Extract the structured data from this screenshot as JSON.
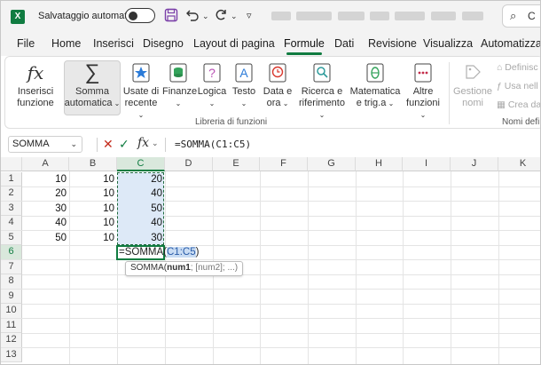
{
  "titlebar": {
    "app_icon": "X",
    "autosave_label": "Salvataggio automatico",
    "autosave_state": "off",
    "icons": [
      "save-icon",
      "undo-icon",
      "redo-icon",
      "customize-icon"
    ],
    "search_label": "C"
  },
  "tabs": [
    {
      "label": "File"
    },
    {
      "label": "Home"
    },
    {
      "label": "Inserisci"
    },
    {
      "label": "Disegno"
    },
    {
      "label": "Layout di pagina"
    },
    {
      "label": "Formule",
      "active": true
    },
    {
      "label": "Dati"
    },
    {
      "label": "Revisione"
    },
    {
      "label": "Visualizza"
    },
    {
      "label": "Automatizza"
    }
  ],
  "ribbon": {
    "insert_function": {
      "line1": "Inserisci",
      "line2": "funzione",
      "icon": "fx-icon"
    },
    "autosum": {
      "line1": "Somma",
      "line2": "automatica",
      "icon": "sigma-icon"
    },
    "recent": {
      "line1": "Usate di",
      "line2": "recente",
      "icon": "star-icon"
    },
    "finance": {
      "line1": "Finanze",
      "icon": "finance-icon"
    },
    "logic": {
      "line1": "Logica",
      "icon": "question-icon"
    },
    "text": {
      "line1": "Testo",
      "icon": "text-icon"
    },
    "datetime": {
      "line1": "Data e",
      "line2": "ora",
      "icon": "clock-icon"
    },
    "lookup": {
      "line1": "Ricerca e",
      "line2": "riferimento",
      "icon": "lookup-icon"
    },
    "math": {
      "line1": "Matematica",
      "line2": "e trig.a",
      "icon": "theta-icon"
    },
    "more": {
      "line1": "Altre",
      "line2": "funzioni",
      "icon": "more-functions-icon"
    },
    "group_label": "Libreria di funzioni",
    "names": {
      "line1": "Gestione",
      "line2": "nomi",
      "icon": "tag-icon"
    },
    "define": "Definisc",
    "use_in": "Usa nell",
    "create_from": "Crea da",
    "names_group_label": "Nomi defin"
  },
  "formula_bar": {
    "name_box": "SOMMA",
    "formula": "=SOMMA(C1:C5)"
  },
  "grid": {
    "columns": [
      "A",
      "B",
      "C",
      "D",
      "E",
      "F",
      "G",
      "H",
      "I",
      "J",
      "K"
    ],
    "rows": [
      "1",
      "2",
      "3",
      "4",
      "5",
      "6",
      "7",
      "8",
      "9",
      "10",
      "11",
      "12",
      "13"
    ],
    "values": [
      [
        "10",
        "10",
        "20"
      ],
      [
        "20",
        "10",
        "40"
      ],
      [
        "30",
        "10",
        "50"
      ],
      [
        "40",
        "10",
        "40"
      ],
      [
        "50",
        "10",
        "30"
      ]
    ],
    "edit_prefix": "=SOMMA(",
    "edit_ref": "C1:C5",
    "edit_suffix": ")",
    "tooltip_fn": "SOMMA(",
    "tooltip_arg": "num1",
    "tooltip_rest": "; [num2]; ...)"
  },
  "colors": {
    "accent": "#107c41",
    "range_fill": "#dde9f7"
  }
}
